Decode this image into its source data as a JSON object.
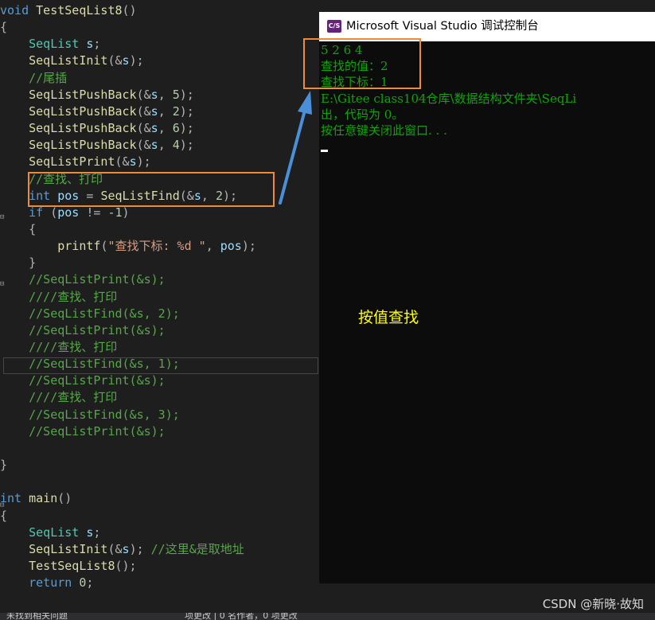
{
  "editor": {
    "lines": [
      [
        [
          "kw",
          "void "
        ],
        [
          "fn",
          "TestSeqList8"
        ],
        [
          "op",
          "()"
        ]
      ],
      [
        [
          "op",
          "{"
        ]
      ],
      [
        [
          "ty",
          "    SeqList "
        ],
        [
          "var",
          "s"
        ],
        [
          "op",
          ";"
        ]
      ],
      [
        [
          "fn",
          "    SeqListInit"
        ],
        [
          "op",
          "(&"
        ],
        [
          "var",
          "s"
        ],
        [
          "op",
          ");"
        ]
      ],
      [
        [
          "cm",
          "    //尾插"
        ]
      ],
      [
        [
          "fn",
          "    SeqListPushBack"
        ],
        [
          "op",
          "(&"
        ],
        [
          "var",
          "s"
        ],
        [
          "op",
          ", "
        ],
        [
          "num",
          "5"
        ],
        [
          "op",
          ");"
        ]
      ],
      [
        [
          "fn",
          "    SeqListPushBack"
        ],
        [
          "op",
          "(&"
        ],
        [
          "var",
          "s"
        ],
        [
          "op",
          ", "
        ],
        [
          "num",
          "2"
        ],
        [
          "op",
          ");"
        ]
      ],
      [
        [
          "fn",
          "    SeqListPushBack"
        ],
        [
          "op",
          "(&"
        ],
        [
          "var",
          "s"
        ],
        [
          "op",
          ", "
        ],
        [
          "num",
          "6"
        ],
        [
          "op",
          ");"
        ]
      ],
      [
        [
          "fn",
          "    SeqListPushBack"
        ],
        [
          "op",
          "(&"
        ],
        [
          "var",
          "s"
        ],
        [
          "op",
          ", "
        ],
        [
          "num",
          "4"
        ],
        [
          "op",
          ");"
        ]
      ],
      [
        [
          "fn",
          "    SeqListPrint"
        ],
        [
          "op",
          "(&"
        ],
        [
          "var",
          "s"
        ],
        [
          "op",
          ");"
        ]
      ],
      [
        [
          "cm",
          "    //查找、打印"
        ]
      ],
      [
        [
          "kw",
          "    int "
        ],
        [
          "var",
          "pos"
        ],
        [
          "op",
          " = "
        ],
        [
          "fn",
          "SeqListFind"
        ],
        [
          "op",
          "(&"
        ],
        [
          "var",
          "s"
        ],
        [
          "op",
          ", "
        ],
        [
          "num",
          "2"
        ],
        [
          "op",
          ");"
        ]
      ],
      [
        [
          "kw",
          "    if "
        ],
        [
          "op",
          "("
        ],
        [
          "var",
          "pos"
        ],
        [
          "op",
          " != "
        ],
        [
          "num",
          "-1"
        ],
        [
          "op",
          ")"
        ]
      ],
      [
        [
          "op",
          "    {"
        ]
      ],
      [
        [
          "fn",
          "        printf"
        ],
        [
          "op",
          "("
        ],
        [
          "str",
          "\"查找下标: %d \""
        ],
        [
          "op",
          ", "
        ],
        [
          "var",
          "pos"
        ],
        [
          "op",
          ");"
        ]
      ],
      [
        [
          "op",
          "    }"
        ]
      ],
      [
        [
          "cm",
          "    //SeqListPrint(&s);"
        ]
      ],
      [
        [
          "cm",
          "    ////查找、打印"
        ]
      ],
      [
        [
          "cm",
          "    //SeqListFind(&s, 2);"
        ]
      ],
      [
        [
          "cm",
          "    //SeqListPrint(&s);"
        ]
      ],
      [
        [
          "cm",
          "    ////查找、打印"
        ]
      ],
      [
        [
          "cm",
          "    //SeqListFind(&s, 1);"
        ]
      ],
      [
        [
          "cm",
          "    //SeqListPrint(&s);"
        ]
      ],
      [
        [
          "cm",
          "    ////查找、打印"
        ]
      ],
      [
        [
          "cm",
          "    //SeqListFind(&s, 3);"
        ]
      ],
      [
        [
          "cm",
          "    //SeqListPrint(&s);"
        ]
      ],
      [
        [
          "op",
          ""
        ]
      ],
      [
        [
          "op",
          "}"
        ]
      ],
      [
        [
          "op",
          ""
        ]
      ],
      [
        [
          "kw",
          "int "
        ],
        [
          "fn",
          "main"
        ],
        [
          "op",
          "()"
        ]
      ],
      [
        [
          "op",
          "{"
        ]
      ],
      [
        [
          "ty",
          "    SeqList "
        ],
        [
          "var",
          "s"
        ],
        [
          "op",
          ";"
        ]
      ],
      [
        [
          "fn",
          "    SeqListInit"
        ],
        [
          "op",
          "(&"
        ],
        [
          "var",
          "s"
        ],
        [
          "op",
          "); "
        ],
        [
          "cm",
          "//这里&是取地址"
        ]
      ],
      [
        [
          "fn",
          "    TestSeqList8"
        ],
        [
          "op",
          "();"
        ]
      ],
      [
        [
          "kw",
          "    return "
        ],
        [
          "num",
          "0"
        ],
        [
          "op",
          ";"
        ]
      ]
    ]
  },
  "console": {
    "title": "Microsoft Visual Studio 调试控制台",
    "icon_label": "C/S",
    "lines": [
      "5 2 6 4",
      "查找的值：2",
      "查找下标：1",
      "E:\\Gitee class104仓库\\数据结构文件夹\\SeqLi",
      "出，代码为 0。",
      "按任意键关闭此窗口. . ."
    ]
  },
  "annotation": {
    "label": "按值查找",
    "color": "#ef8b35",
    "arrow_color": "#4a90d9"
  },
  "watermark": "CSDN @新晓·故知",
  "bottom_strip": {
    "items": [
      "未找到相关问题",
      "项更改 | 0 名作者，0 项更改"
    ]
  },
  "colors": {
    "editor_bg": "#1e1e1e",
    "console_bg": "#0c0c0c",
    "console_text": "#13a10e",
    "label": "#ffff00"
  }
}
